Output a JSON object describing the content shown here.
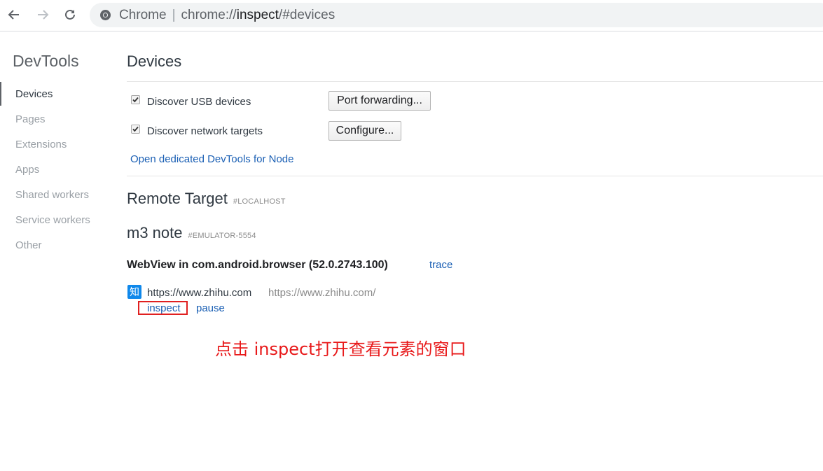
{
  "browser": {
    "site_label": "Chrome",
    "url_prefix": "chrome://",
    "url_host": "inspect",
    "url_path": "/#devices"
  },
  "sidebar": {
    "title": "DevTools",
    "items": [
      {
        "label": "Devices",
        "active": true
      },
      {
        "label": "Pages"
      },
      {
        "label": "Extensions"
      },
      {
        "label": "Apps"
      },
      {
        "label": "Shared workers"
      },
      {
        "label": "Service workers"
      },
      {
        "label": "Other"
      }
    ]
  },
  "devices": {
    "title": "Devices",
    "usb_label": "Discover USB devices",
    "usb_checked": true,
    "port_forwarding_button": "Port forwarding...",
    "network_label": "Discover network targets",
    "network_checked": true,
    "configure_button": "Configure...",
    "node_link": "Open dedicated DevTools for Node"
  },
  "remote": {
    "title": "Remote Target",
    "tag": "#LOCALHOST",
    "device_name": "m3 note",
    "device_tag": "#EMULATOR-5554",
    "webview_title": "WebView in com.android.browser (52.0.2743.100)",
    "trace_link": "trace",
    "page_favicon": "知",
    "page_title": "https://www.zhihu.com",
    "page_url": "https://www.zhihu.com/",
    "inspect_link": "inspect",
    "pause_link": "pause"
  },
  "annotation": {
    "text": "点击 inspect打开查看元素的窗口",
    "color": "#e8191a"
  }
}
